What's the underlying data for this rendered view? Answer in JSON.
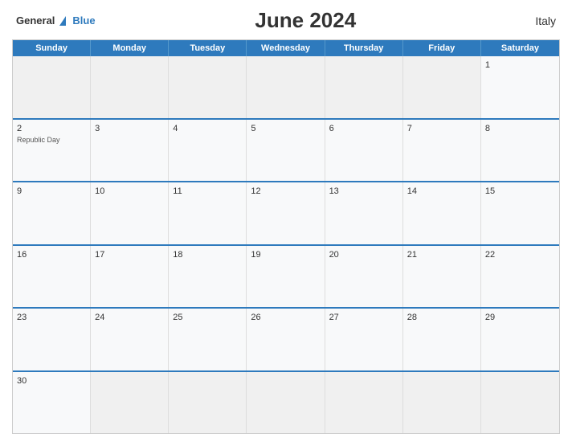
{
  "header": {
    "logo": {
      "general": "General",
      "blue": "Blue"
    },
    "title": "June 2024",
    "country": "Italy"
  },
  "calendar": {
    "dayHeaders": [
      "Sunday",
      "Monday",
      "Tuesday",
      "Wednesday",
      "Thursday",
      "Friday",
      "Saturday"
    ],
    "weeks": [
      [
        {
          "day": "",
          "holiday": ""
        },
        {
          "day": "",
          "holiday": ""
        },
        {
          "day": "",
          "holiday": ""
        },
        {
          "day": "",
          "holiday": ""
        },
        {
          "day": "",
          "holiday": ""
        },
        {
          "day": "",
          "holiday": ""
        },
        {
          "day": "1",
          "holiday": ""
        }
      ],
      [
        {
          "day": "2",
          "holiday": "Republic Day"
        },
        {
          "day": "3",
          "holiday": ""
        },
        {
          "day": "4",
          "holiday": ""
        },
        {
          "day": "5",
          "holiday": ""
        },
        {
          "day": "6",
          "holiday": ""
        },
        {
          "day": "7",
          "holiday": ""
        },
        {
          "day": "8",
          "holiday": ""
        }
      ],
      [
        {
          "day": "9",
          "holiday": ""
        },
        {
          "day": "10",
          "holiday": ""
        },
        {
          "day": "11",
          "holiday": ""
        },
        {
          "day": "12",
          "holiday": ""
        },
        {
          "day": "13",
          "holiday": ""
        },
        {
          "day": "14",
          "holiday": ""
        },
        {
          "day": "15",
          "holiday": ""
        }
      ],
      [
        {
          "day": "16",
          "holiday": ""
        },
        {
          "day": "17",
          "holiday": ""
        },
        {
          "day": "18",
          "holiday": ""
        },
        {
          "day": "19",
          "holiday": ""
        },
        {
          "day": "20",
          "holiday": ""
        },
        {
          "day": "21",
          "holiday": ""
        },
        {
          "day": "22",
          "holiday": ""
        }
      ],
      [
        {
          "day": "23",
          "holiday": ""
        },
        {
          "day": "24",
          "holiday": ""
        },
        {
          "day": "25",
          "holiday": ""
        },
        {
          "day": "26",
          "holiday": ""
        },
        {
          "day": "27",
          "holiday": ""
        },
        {
          "day": "28",
          "holiday": ""
        },
        {
          "day": "29",
          "holiday": ""
        }
      ],
      [
        {
          "day": "30",
          "holiday": ""
        },
        {
          "day": "",
          "holiday": ""
        },
        {
          "day": "",
          "holiday": ""
        },
        {
          "day": "",
          "holiday": ""
        },
        {
          "day": "",
          "holiday": ""
        },
        {
          "day": "",
          "holiday": ""
        },
        {
          "day": "",
          "holiday": ""
        }
      ]
    ]
  },
  "colors": {
    "headerBg": "#2e7abd",
    "accent": "#2e7abd"
  }
}
